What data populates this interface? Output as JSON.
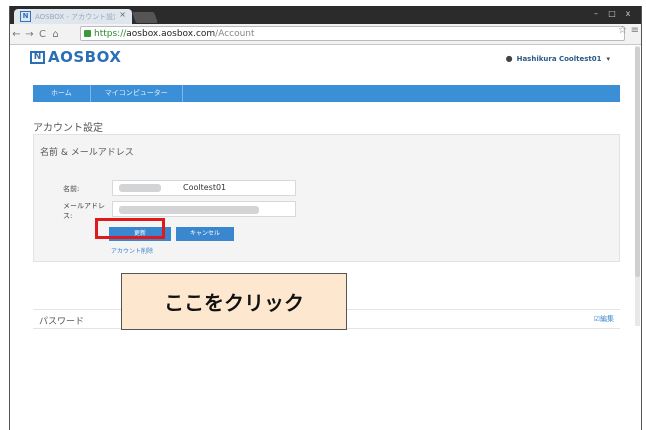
{
  "browser": {
    "tab_title": "AOSBOX - アカウント設定",
    "tab_close": "×",
    "win_controls": [
      "–",
      "□",
      "x"
    ],
    "url_scheme": "https://",
    "url_host": "aosbox.aosbox.com",
    "url_path": "/Account",
    "nav_icons": {
      "back": "←",
      "forward": "→",
      "reload": "C",
      "home": "⌂"
    }
  },
  "site": {
    "logo_mark": "N",
    "logo_text": "AOSBOX",
    "user_name": "Hashikura Cooltest01",
    "user_caret": "▾"
  },
  "navbar": {
    "items": [
      "ホーム",
      "マイコンピューター"
    ]
  },
  "main": {
    "page_title": "アカウント設定",
    "panel_title": "名前 & メールアドレス",
    "name_label": "名前:",
    "name_value": "Cooltest01",
    "email_label_1": "メールアドレ",
    "email_label_2": "ス:",
    "update_button": "更新",
    "cancel_button": "キャンセル",
    "delete_link": "アカウント削除",
    "password_label": "パスワード",
    "edit_link": "☑編集"
  },
  "callout": {
    "text": "ここをクリック"
  },
  "colors": {
    "brand": "#2a6fb5",
    "navbar": "#3b8fd6",
    "highlight": "#e01a1a",
    "callout_bg": "#fde8cf"
  }
}
